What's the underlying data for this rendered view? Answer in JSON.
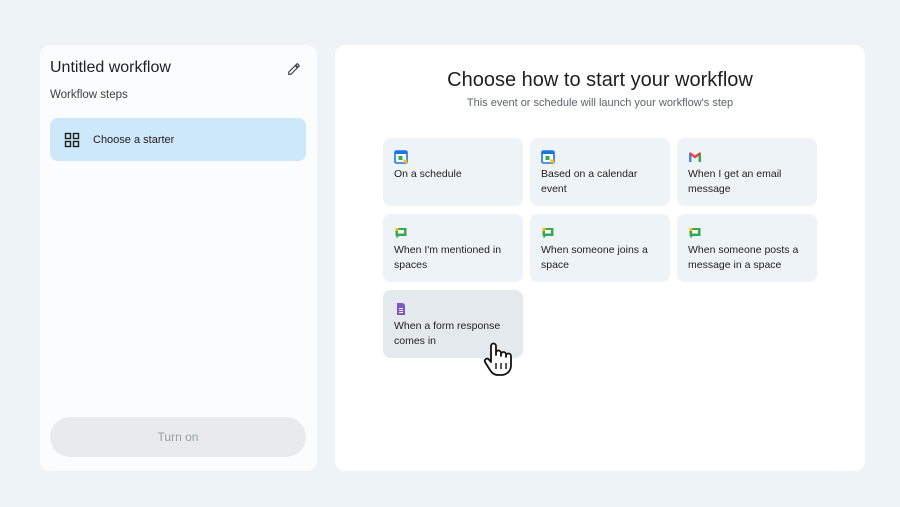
{
  "left_panel": {
    "title": "Untitled workflow",
    "steps_label": "Workflow steps",
    "starter_label": "Choose a starter",
    "turn_on_label": "Turn on"
  },
  "main": {
    "heading": "Choose how to start your workflow",
    "subheading": "This event or schedule will launch your workflow's step",
    "options": [
      {
        "label": "On a schedule",
        "icon": "calendar-icon"
      },
      {
        "label": "Based on a calendar event",
        "icon": "calendar-icon"
      },
      {
        "label": "When I get an email message",
        "icon": "gmail-icon"
      },
      {
        "label": "When I'm mentioned in spaces",
        "icon": "chat-icon"
      },
      {
        "label": "When someone joins a space",
        "icon": "chat-icon"
      },
      {
        "label": "When someone posts a message in a space",
        "icon": "chat-icon"
      },
      {
        "label": "When a form response comes in",
        "icon": "forms-icon"
      }
    ]
  },
  "colors": {
    "selected_bg": "#cde7fb",
    "card_bg": "#eef3f8",
    "accent_blue": "#1a73e8"
  }
}
